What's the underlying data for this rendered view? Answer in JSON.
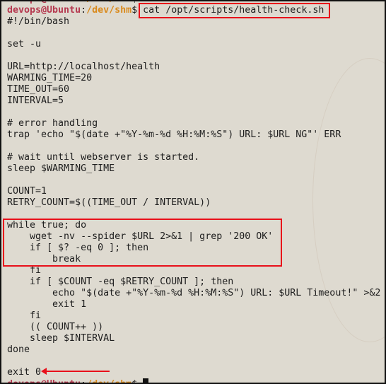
{
  "prompt": {
    "user_host": "devops@Ubuntu",
    "sep": ":",
    "path": "/dev/shm",
    "symbol": "$"
  },
  "command": "cat /opt/scripts/health-check.sh",
  "script_lines": [
    "#!/bin/bash",
    "",
    "set -u",
    "",
    "URL=http://localhost/health",
    "WARMING_TIME=20",
    "TIME_OUT=60",
    "INTERVAL=5",
    "",
    "# error handling",
    "trap 'echo \"$(date +\"%Y-%m-%d %H:%M:%S\") URL: $URL NG\"' ERR",
    "",
    "# wait until webserver is started.",
    "sleep $WARMING_TIME",
    "",
    "COUNT=1",
    "RETRY_COUNT=$((TIME_OUT / INTERVAL))",
    "",
    "while true; do",
    "    wget -nv --spider $URL 2>&1 | grep '200 OK'",
    "    if [ $? -eq 0 ]; then",
    "        break",
    "    fi",
    "    if [ $COUNT -eq $RETRY_COUNT ]; then",
    "        echo \"$(date +\"%Y-%m-%d %H:%M:%S\") URL: $URL Timeout!\" >&2",
    "        exit 1",
    "    fi",
    "    (( COUNT++ ))",
    "    sleep $INTERVAL",
    "done",
    "",
    "exit 0"
  ],
  "colors": {
    "annotation": "#e8101a",
    "user": "#b5384f",
    "path": "#d98a1c",
    "background": "#dedad0"
  }
}
